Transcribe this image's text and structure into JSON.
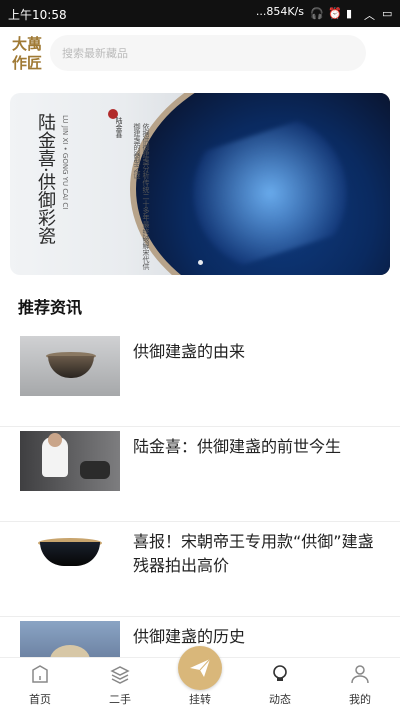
{
  "status_bar": {
    "time": "上午10:58",
    "network": "...854K/s"
  },
  "header": {
    "logo_text": "大萬作匠",
    "search_placeholder": "搜索最新藏品"
  },
  "banner": {
    "title": "陆金喜·供御彩瓷",
    "subtitle": "LU JIN XI • GONG YU CAI CI",
    "description": "依据供御建盏分析传统二十多年最终破解宋代供御建盏的器型之谜",
    "signature": "陆金喜"
  },
  "section": {
    "title": "推荐资讯"
  },
  "articles": [
    {
      "title": "供御建盏的由来",
      "thumb": "bowl-photo"
    },
    {
      "title": "陆金喜：供御建盏的前世今生",
      "thumb": "artisan-photo"
    },
    {
      "title": "喜报！宋朝帝王专用款“供御”建盏残器拍出高价",
      "thumb": "black-bowl-photo"
    },
    {
      "title": "供御建盏的历史",
      "thumb": "relic-photo"
    }
  ],
  "tabbar": {
    "items": [
      {
        "label": "首页",
        "icon": "home-icon"
      },
      {
        "label": "二手",
        "icon": "layers-icon"
      },
      {
        "label": "挂转",
        "icon": "paper-plane-icon"
      },
      {
        "label": "动态",
        "icon": "bulb-icon"
      },
      {
        "label": "我的",
        "icon": "user-icon"
      }
    ]
  },
  "colors": {
    "accent": "#d9b77a",
    "brand_gold": "#a07a35"
  }
}
